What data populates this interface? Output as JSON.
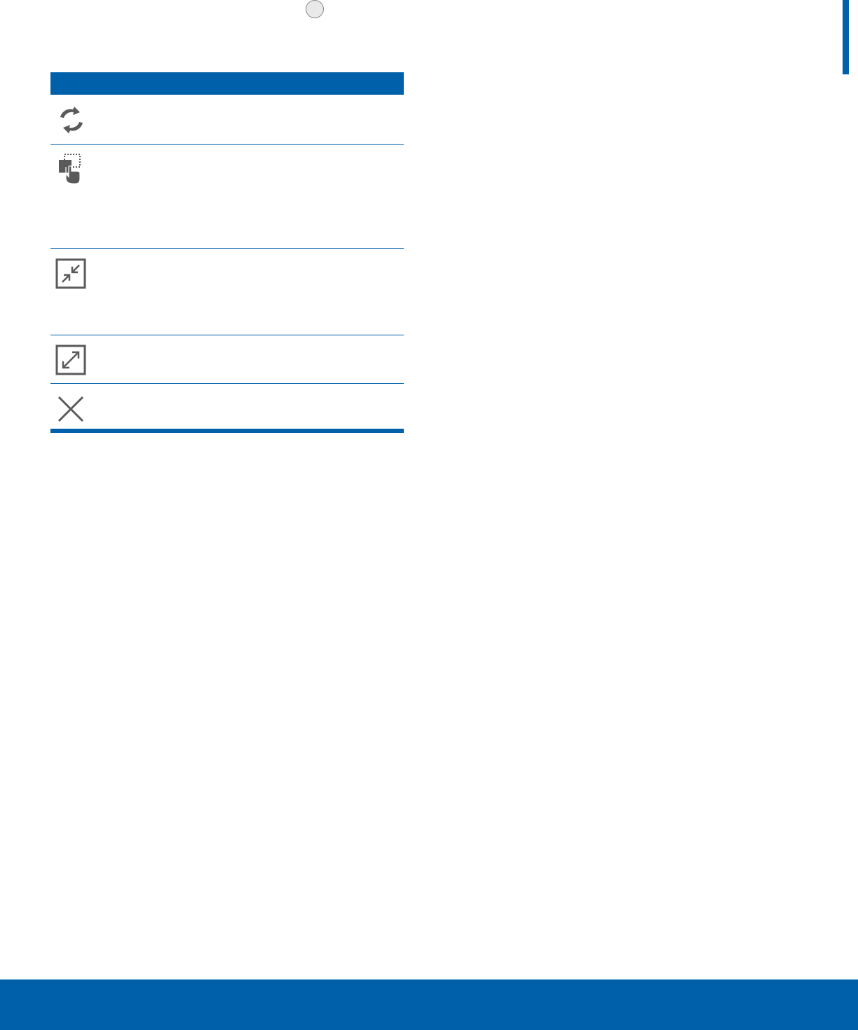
{
  "colors": {
    "accent": "#0061aa",
    "icon": "#5a5a5a"
  },
  "table": {
    "header": "",
    "rows": [
      {
        "icon": "switch-windows-icon",
        "text": ""
      },
      {
        "icon": "drag-and-drop-icon",
        "text": ""
      },
      {
        "icon": "minimize-window-icon",
        "text": ""
      },
      {
        "icon": "maximize-window-icon",
        "text": ""
      },
      {
        "icon": "close-icon",
        "text": ""
      }
    ]
  },
  "footer": {
    "text": ""
  }
}
